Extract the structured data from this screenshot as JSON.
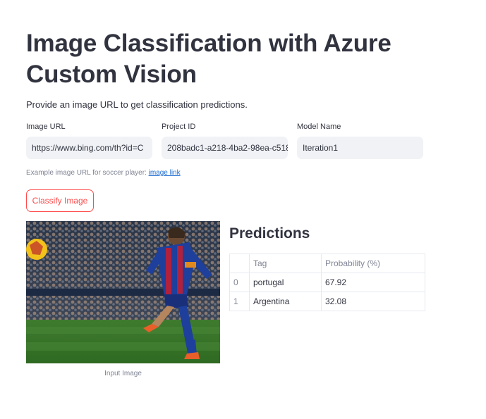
{
  "page": {
    "title": "Image Classification with Azure Custom Vision",
    "description": "Provide an image URL to get classification predictions."
  },
  "form": {
    "image_url": {
      "label": "Image URL",
      "value": "https://www.bing.com/th?id=C"
    },
    "project_id": {
      "label": "Project ID",
      "value": "208badc1-a218-4ba2-98ea-c518"
    },
    "model_name": {
      "label": "Model Name",
      "value": "Iteration1"
    }
  },
  "example": {
    "text": "Example image URL for soccer player: ",
    "link_label": "image link"
  },
  "classify_button": "Classify Image",
  "image": {
    "caption": "Input Image"
  },
  "predictions": {
    "title": "Predictions",
    "columns": [
      "",
      "Tag",
      "Probability (%)"
    ],
    "rows": [
      {
        "index": "0",
        "tag": "portugal",
        "probability": "67.92"
      },
      {
        "index": "1",
        "tag": "Argentina",
        "probability": "32.08"
      }
    ]
  }
}
